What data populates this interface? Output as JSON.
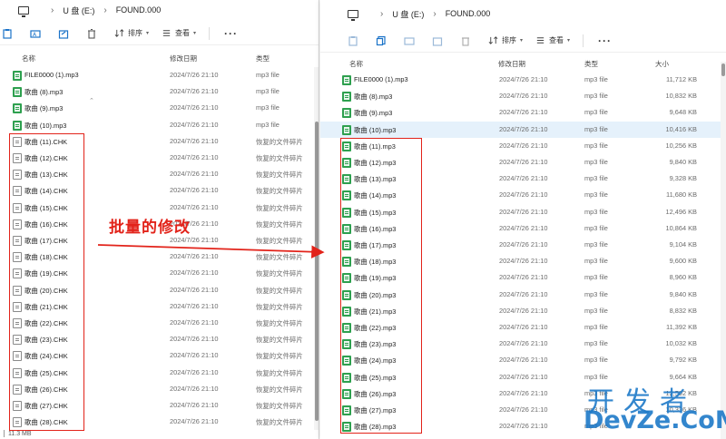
{
  "breadcrumb": {
    "drive": "U 盘 (E:)",
    "folder": "FOUND.000"
  },
  "toolbar": {
    "sort_label": "排序",
    "view_label": "查看",
    "more_label": "···"
  },
  "columns": {
    "name": "名称",
    "date": "修改日期",
    "type": "类型",
    "size": "大小"
  },
  "left_pane": {
    "rows": [
      {
        "name": "FILE0000 (1).mp3",
        "date": "2024/7/26 21:10",
        "type": "mp3 file",
        "icon": "mp3-file-icon"
      },
      {
        "name": "歌曲 (8).mp3",
        "date": "2024/7/26 21:10",
        "type": "mp3 file",
        "icon": "mp3-file-icon"
      },
      {
        "name": "歌曲 (9).mp3",
        "date": "2024/7/26 21:10",
        "type": "mp3 file",
        "icon": "mp3-file-icon"
      },
      {
        "name": "歌曲 (10).mp3",
        "date": "2024/7/26 21:10",
        "type": "mp3 file",
        "icon": "mp3-file-icon"
      },
      {
        "name": "歌曲 (11).CHK",
        "date": "2024/7/26 21:10",
        "type": "恢复的文件碎片",
        "icon": "chk-file-icon"
      },
      {
        "name": "歌曲 (12).CHK",
        "date": "2024/7/26 21:10",
        "type": "恢复的文件碎片",
        "icon": "chk-file-icon"
      },
      {
        "name": "歌曲 (13).CHK",
        "date": "2024/7/26 21:10",
        "type": "恢复的文件碎片",
        "icon": "chk-file-icon"
      },
      {
        "name": "歌曲 (14).CHK",
        "date": "2024/7/26 21:10",
        "type": "恢复的文件碎片",
        "icon": "chk-file-icon"
      },
      {
        "name": "歌曲 (15).CHK",
        "date": "2024/7/26 21:10",
        "type": "恢复的文件碎片",
        "icon": "chk-file-icon"
      },
      {
        "name": "歌曲 (16).CHK",
        "date": "2024/7/26 21:10",
        "type": "恢复的文件碎片",
        "icon": "chk-file-icon"
      },
      {
        "name": "歌曲 (17).CHK",
        "date": "2024/7/26 21:10",
        "type": "恢复的文件碎片",
        "icon": "chk-file-icon"
      },
      {
        "name": "歌曲 (18).CHK",
        "date": "2024/7/26 21:10",
        "type": "恢复的文件碎片",
        "icon": "chk-file-icon"
      },
      {
        "name": "歌曲 (19).CHK",
        "date": "2024/7/26 21:10",
        "type": "恢复的文件碎片",
        "icon": "chk-file-icon"
      },
      {
        "name": "歌曲 (20).CHK",
        "date": "2024/7/26 21:10",
        "type": "恢复的文件碎片",
        "icon": "chk-file-icon"
      },
      {
        "name": "歌曲 (21).CHK",
        "date": "2024/7/26 21:10",
        "type": "恢复的文件碎片",
        "icon": "chk-file-icon"
      },
      {
        "name": "歌曲 (22).CHK",
        "date": "2024/7/26 21:10",
        "type": "恢复的文件碎片",
        "icon": "chk-file-icon"
      },
      {
        "name": "歌曲 (23).CHK",
        "date": "2024/7/26 21:10",
        "type": "恢复的文件碎片",
        "icon": "chk-file-icon"
      },
      {
        "name": "歌曲 (24).CHK",
        "date": "2024/7/26 21:10",
        "type": "恢复的文件碎片",
        "icon": "chk-file-icon"
      },
      {
        "name": "歌曲 (25).CHK",
        "date": "2024/7/26 21:10",
        "type": "恢复的文件碎片",
        "icon": "chk-file-icon"
      },
      {
        "name": "歌曲 (26).CHK",
        "date": "2024/7/26 21:10",
        "type": "恢复的文件碎片",
        "icon": "chk-file-icon"
      },
      {
        "name": "歌曲 (27).CHK",
        "date": "2024/7/26 21:10",
        "type": "恢复的文件碎片",
        "icon": "chk-file-icon"
      },
      {
        "name": "歌曲 (28).CHK",
        "date": "2024/7/26 21:10",
        "type": "恢复的文件碎片",
        "icon": "chk-file-icon"
      }
    ],
    "status": "11.3 MB"
  },
  "right_pane": {
    "rows": [
      {
        "name": "FILE0000 (1).mp3",
        "date": "2024/7/26 21:10",
        "type": "mp3 file",
        "size": "11,712 KB",
        "icon": "mp3-file-icon"
      },
      {
        "name": "歌曲 (8).mp3",
        "date": "2024/7/26 21:10",
        "type": "mp3 file",
        "size": "10,832 KB",
        "icon": "mp3-file-icon"
      },
      {
        "name": "歌曲 (9).mp3",
        "date": "2024/7/26 21:10",
        "type": "mp3 file",
        "size": "9,648 KB",
        "icon": "mp3-file-icon"
      },
      {
        "name": "歌曲 (10).mp3",
        "date": "2024/7/26 21:10",
        "type": "mp3 file",
        "size": "10,416 KB",
        "icon": "mp3-file-icon"
      },
      {
        "name": "歌曲 (11).mp3",
        "date": "2024/7/26 21:10",
        "type": "mp3 file",
        "size": "10,256 KB",
        "icon": "mp3-file-icon"
      },
      {
        "name": "歌曲 (12).mp3",
        "date": "2024/7/26 21:10",
        "type": "mp3 file",
        "size": "9,840 KB",
        "icon": "mp3-file-icon"
      },
      {
        "name": "歌曲 (13).mp3",
        "date": "2024/7/26 21:10",
        "type": "mp3 file",
        "size": "9,328 KB",
        "icon": "mp3-file-icon"
      },
      {
        "name": "歌曲 (14).mp3",
        "date": "2024/7/26 21:10",
        "type": "mp3 file",
        "size": "11,680 KB",
        "icon": "mp3-file-icon"
      },
      {
        "name": "歌曲 (15).mp3",
        "date": "2024/7/26 21:10",
        "type": "mp3 file",
        "size": "12,496 KB",
        "icon": "mp3-file-icon"
      },
      {
        "name": "歌曲 (16).mp3",
        "date": "2024/7/26 21:10",
        "type": "mp3 file",
        "size": "10,864 KB",
        "icon": "mp3-file-icon"
      },
      {
        "name": "歌曲 (17).mp3",
        "date": "2024/7/26 21:10",
        "type": "mp3 file",
        "size": "9,104 KB",
        "icon": "mp3-file-icon"
      },
      {
        "name": "歌曲 (18).mp3",
        "date": "2024/7/26 21:10",
        "type": "mp3 file",
        "size": "9,600 KB",
        "icon": "mp3-file-icon"
      },
      {
        "name": "歌曲 (19).mp3",
        "date": "2024/7/26 21:10",
        "type": "mp3 file",
        "size": "8,960 KB",
        "icon": "mp3-file-icon"
      },
      {
        "name": "歌曲 (20).mp3",
        "date": "2024/7/26 21:10",
        "type": "mp3 file",
        "size": "9,840 KB",
        "icon": "mp3-file-icon"
      },
      {
        "name": "歌曲 (21).mp3",
        "date": "2024/7/26 21:10",
        "type": "mp3 file",
        "size": "8,832 KB",
        "icon": "mp3-file-icon"
      },
      {
        "name": "歌曲 (22).mp3",
        "date": "2024/7/26 21:10",
        "type": "mp3 file",
        "size": "11,392 KB",
        "icon": "mp3-file-icon"
      },
      {
        "name": "歌曲 (23).mp3",
        "date": "2024/7/26 21:10",
        "type": "mp3 file",
        "size": "10,032 KB",
        "icon": "mp3-file-icon"
      },
      {
        "name": "歌曲 (24).mp3",
        "date": "2024/7/26 21:10",
        "type": "mp3 file",
        "size": "9,792 KB",
        "icon": "mp3-file-icon"
      },
      {
        "name": "歌曲 (25).mp3",
        "date": "2024/7/26 21:10",
        "type": "mp3 file",
        "size": "9,664 KB",
        "icon": "mp3-file-icon"
      },
      {
        "name": "歌曲 (26).mp3",
        "date": "2024/7/26 21:10",
        "type": "mp3 file",
        "size": "12,592 KB",
        "icon": "mp3-file-icon"
      },
      {
        "name": "歌曲 (27).mp3",
        "date": "2024/7/26 21:10",
        "type": "mp3 file",
        "size": "10,336 KB",
        "icon": "mp3-file-icon"
      },
      {
        "name": "歌曲 (28).mp3",
        "date": "2024/7/26 21:10",
        "type": "mp3 file",
        "size": "",
        "icon": "mp3-file-icon"
      }
    ]
  },
  "annotation": {
    "label": "批量的修改",
    "color": "#e2231a"
  },
  "watermark": {
    "top": "开发者",
    "bottom": "DevZe.CoM",
    "color": "#1e7ac8"
  },
  "colors": {
    "selection": "#e5f1fb",
    "mp3_icon": "#2ea04f"
  }
}
